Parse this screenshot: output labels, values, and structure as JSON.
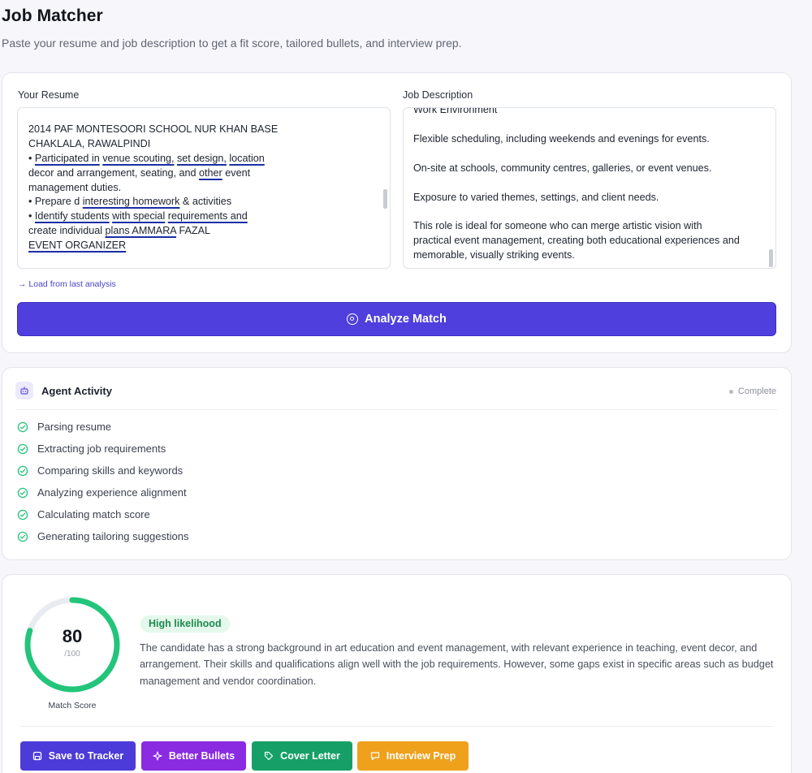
{
  "header": {
    "title": "Job Matcher",
    "subtitle": "Paste your resume and job description to get a fit score, tailored bullets, and interview prep."
  },
  "inputs": {
    "resume_label": "Your Resume",
    "resume_lines": {
      "l1": " 2014   PAF MONTESOORI SCHOOL NUR KHAN BASE",
      "l2": "CHAKLALA, RAWALPINDI",
      "l3a": "   • ",
      "l3b": "Participated  in",
      "l3c": " ",
      "l3d": "venue  scouting,",
      "l3e": "  ",
      "l3f": "set  design,",
      "l3g": "  ",
      "l3h": "location",
      "l4a": "decor and arrangement, seating, and ",
      "l4b": "other",
      "l4c": " event",
      "l5": "management duties.",
      "l6a": "• Prepare d ",
      "l6b": "interesting  homework",
      "l6c": "  & activities",
      "l7a": "• ",
      "l7b": "Identify  students",
      "l7c": "  ",
      "l7d": "with  special",
      "l7e": "  ",
      "l7f": "requirements  and",
      "l8a": "create individual ",
      "l8b": "plans  AMMARA",
      "l8c": " FAZAL",
      "l9": "EVENT  ORGANIZER"
    },
    "job_label": "Job Description",
    "job_lines": {
      "j0": "Work Environment",
      "j1": "Flexible scheduling, including weekends and evenings for events.",
      "j2": "On-site at schools, community centres, galleries, or event venues.",
      "j3": "Exposure to varied themes, settings, and client needs.",
      "j4": "This role is ideal for someone who can merge artistic vision with",
      "j5": "practical event management, creating both educational experiences and",
      "j6": "memorable, visually striking events."
    },
    "load_link": "→ Load from last analysis",
    "analyze_button": "Analyze Match",
    "analyze_icon": "target-icon"
  },
  "activity": {
    "title": "Agent Activity",
    "status": "Complete",
    "steps": [
      "Parsing resume",
      "Extracting job requirements",
      "Comparing skills and keywords",
      "Analyzing experience alignment",
      "Calculating match score",
      "Generating tailoring suggestions"
    ]
  },
  "result": {
    "score": "80",
    "score_max": "/100",
    "score_fraction": 0.8,
    "score_label": "Match Score",
    "likelihood": "High likelihood",
    "summary": "The candidate has a strong background in art education and event management, with relevant experience in teaching, event decor, and arrangement. Their skills and qualifications align well with the job requirements. However, some gaps exist in specific areas such as budget management and vendor coordination.",
    "actions": [
      {
        "label": "Save to Tracker",
        "icon": "save-icon",
        "color": "#4c3bd8"
      },
      {
        "label": "Better Bullets",
        "icon": "sparkle-icon",
        "color": "#8a2be2"
      },
      {
        "label": "Cover Letter",
        "icon": "tag-icon",
        "color": "#16a067"
      },
      {
        "label": "Interview Prep",
        "icon": "chat-icon",
        "color": "#efa11c"
      }
    ]
  },
  "colors": {
    "accent": "#4f3fdc",
    "success": "#22c57a",
    "ring_track": "#e8ebf0"
  }
}
